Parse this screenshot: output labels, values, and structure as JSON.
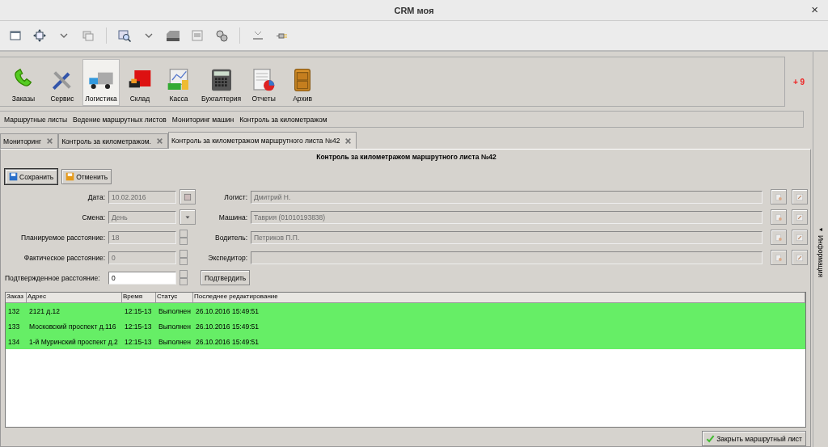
{
  "window": {
    "title": "CRM моя",
    "close": "×"
  },
  "modules": [
    {
      "label": "Заказы",
      "selected": false
    },
    {
      "label": "Сервис",
      "selected": false
    },
    {
      "label": "Логистика",
      "selected": true
    },
    {
      "label": "Склад",
      "selected": false
    },
    {
      "label": "Касса",
      "selected": false
    },
    {
      "label": "Бухгалтерия",
      "selected": false
    },
    {
      "label": "Отчеты",
      "selected": false
    },
    {
      "label": "Архив",
      "selected": false
    }
  ],
  "notification_count": "+ 9",
  "submenu": [
    "Маршрутные листы",
    "Ведение маршрутных листов",
    "Мониторинг машин",
    "Контроль за километражом"
  ],
  "tabs": [
    {
      "label": "Мониторинг",
      "selected": false
    },
    {
      "label": "Контроль за километражом.",
      "selected": false
    },
    {
      "label": "Контроль за километражом маршрутного листа №42",
      "selected": true
    }
  ],
  "heading": "Контроль за километражом маршрутного листа №42",
  "actions": [
    "Сохранить",
    "Отменить"
  ],
  "left_fields": [
    {
      "kind": "date",
      "label": "Дата:",
      "value": "10.02.2016",
      "disabled": true
    },
    {
      "kind": "select",
      "label": "Смена:",
      "value": "День",
      "disabled": true
    },
    {
      "kind": "spinner",
      "label": "Планируемое расстояние:",
      "value": "18",
      "disabled": true
    },
    {
      "kind": "spinner",
      "label": "Фактическое расстояние:",
      "value": "0",
      "disabled": true
    }
  ],
  "right_fields": [
    {
      "label": "Логист:",
      "value": "Дмитрий Н."
    },
    {
      "label": "Машина:",
      "value": "Таврия (01010193838)"
    },
    {
      "label": "Водитель:",
      "value": "Петриков П.П."
    },
    {
      "label": "Экспедитор:"
    }
  ],
  "confirmed": {
    "label": "Подтвержденное расстояние:",
    "value": "0",
    "disabled": false,
    "button": "Подтвердить"
  },
  "table": {
    "columns": [
      "Заказ",
      "Адрес",
      "Время",
      "Статус",
      "Последнее редактирование"
    ],
    "rows": [
      {
        "cells": [
          "132",
          "2121 д.12",
          "12:15-13",
          "Выполнен",
          "26.10.2016 15:49:51"
        ],
        "color": "#66ee66"
      },
      {
        "cells": [
          "133",
          "Московский проспект д.116",
          "12:15-13",
          "Выполнен",
          "26.10.2016 15:49:51"
        ],
        "color": "#66ee66"
      },
      {
        "cells": [
          "134",
          "1-й Муринский проспект д.2",
          "12:15-13",
          "Выполнен",
          "26.10.2016 15:49:51"
        ],
        "color": "#66ee66"
      }
    ]
  },
  "close_button": "Закрыть маршрутный лист",
  "side_panel": {
    "label": "Информация",
    "arrow": "◂"
  }
}
